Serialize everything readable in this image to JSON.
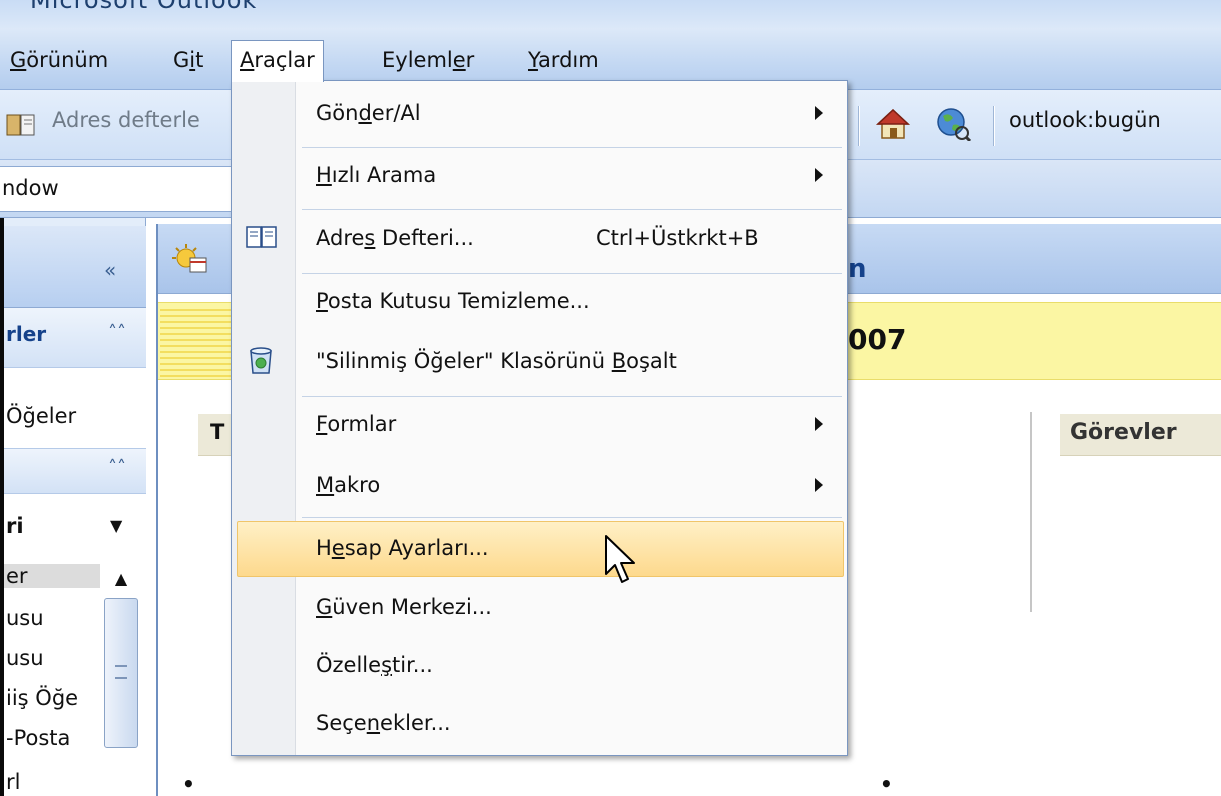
{
  "window": {
    "title_fragment": "Microsoft Outlook"
  },
  "menubar": {
    "items": [
      {
        "label": "Görünüm",
        "u": "G",
        "rest": "örünüm"
      },
      {
        "label": "Git",
        "pre": "G",
        "u": "i",
        "rest": "t"
      },
      {
        "label": "Araçlar",
        "u": "A",
        "rest": "raçlar"
      },
      {
        "label": "Eylemler",
        "pre": "Eyleml",
        "u": "e",
        "rest": "r"
      },
      {
        "label": "Yardım",
        "u": "Y",
        "rest": "ardım"
      }
    ]
  },
  "toolbar": {
    "address_book_text": "Adres defterle",
    "address_value": "outlook:bugün"
  },
  "toolbar2": {
    "field_text": "ndow"
  },
  "nav": {
    "collapse_glyph": "«",
    "section1_label": "rler",
    "section1_item": "Öğeler",
    "dropdown_label": "ri",
    "list_items": [
      "er",
      "usu",
      "usu",
      "iiş Öğe",
      "-Posta",
      "rl"
    ]
  },
  "main": {
    "header_title_fragment": "n",
    "banner_year_fragment": "007",
    "left_column_header": "T",
    "right_column_header": "Görevler"
  },
  "dropdown": {
    "items": [
      {
        "pre": "Gön",
        "u": "d",
        "rest": "er/Al",
        "submenu": true
      },
      {
        "pre": "",
        "u": "H",
        "rest": "ızlı Arama",
        "submenu": true
      },
      {
        "pre": "Adre",
        "u": "s",
        "rest": " Defteri...",
        "shortcut": "Ctrl+Üstkrkt+B",
        "icon": "address-book-icon"
      },
      {
        "pre": "",
        "u": "P",
        "rest": "osta Kutusu Temizleme..."
      },
      {
        "pre": "\"Silinmiş Öğeler\" Klasörünü ",
        "u": "B",
        "rest": "oşalt",
        "icon": "recycle-bin-icon"
      },
      {
        "pre": "",
        "u": "F",
        "rest": "ormlar",
        "submenu": true
      },
      {
        "pre": "",
        "u": "M",
        "rest": "akro",
        "submenu": true
      },
      {
        "pre": "H",
        "u": "e",
        "rest": "sap Ayarları...",
        "highlighted": true
      },
      {
        "pre": "",
        "u": "G",
        "rest": "üven Merkezi..."
      },
      {
        "pre": "Özelle",
        "u": "ş",
        "rest": "tir..."
      },
      {
        "pre": "Seçe",
        "u": "n",
        "rest": "ekler..."
      }
    ]
  }
}
